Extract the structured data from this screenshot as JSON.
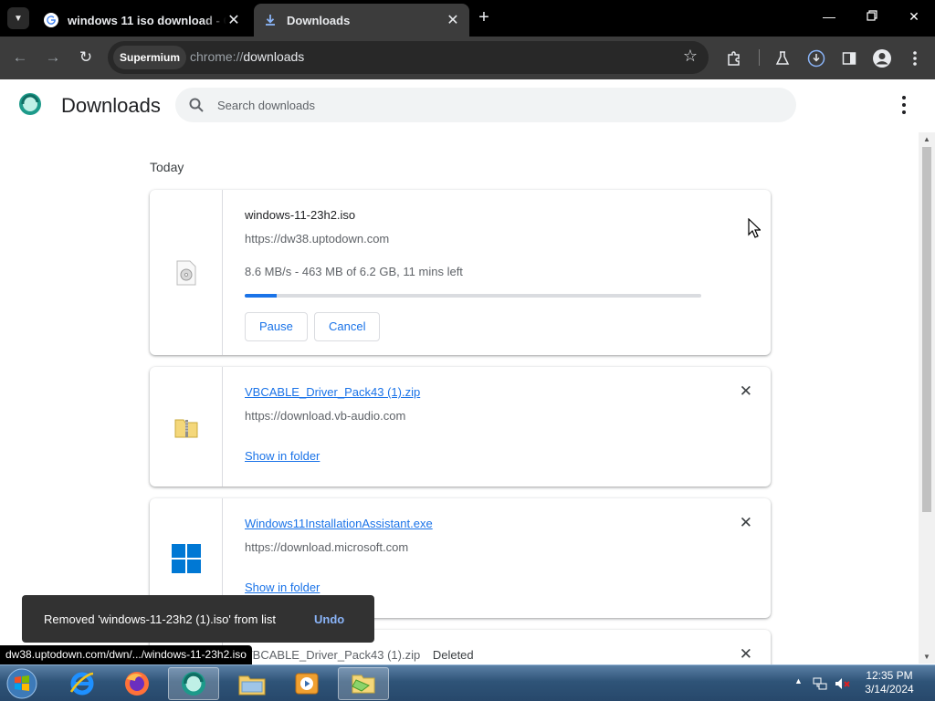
{
  "browser": {
    "tabs": [
      {
        "title": "windows 11 iso download - Go",
        "active": false
      },
      {
        "title": "Downloads",
        "active": true
      }
    ],
    "new_tab": "+",
    "chip": "Supermium",
    "url_prefix": "chrome://",
    "url_path": "downloads"
  },
  "downloads": {
    "title": "Downloads",
    "search_placeholder": "Search downloads",
    "section": "Today",
    "active_item": {
      "filename": "windows-11-23h2.iso",
      "url": "https://dw38.uptodown.com",
      "status": "8.6 MB/s - 463 MB of 6.2 GB, 11 mins left",
      "progress_percent": 7,
      "pause_label": "Pause",
      "cancel_label": "Cancel"
    },
    "items": [
      {
        "filename": "VBCABLE_Driver_Pack43 (1).zip",
        "url": "https://download.vb-audio.com",
        "action": "Show in folder"
      },
      {
        "filename": "Windows11InstallationAssistant.exe",
        "url": "https://download.microsoft.com",
        "action": "Show in folder"
      }
    ],
    "deleted_item": {
      "filename": "VBCABLE_Driver_Pack43 (1).zip",
      "label": "Deleted"
    }
  },
  "toast": {
    "message": "Removed 'windows-11-23h2 (1).iso' from list",
    "undo": "Undo"
  },
  "status_url": "dw38.uptodown.com/dwn/.../windows-11-23h2.iso",
  "taskbar": {
    "time": "12:35 PM",
    "date": "3/14/2024"
  },
  "colors": {
    "accent": "#1a73e8",
    "tab_strip": "#000000",
    "toolbar": "#3c3c3c"
  }
}
